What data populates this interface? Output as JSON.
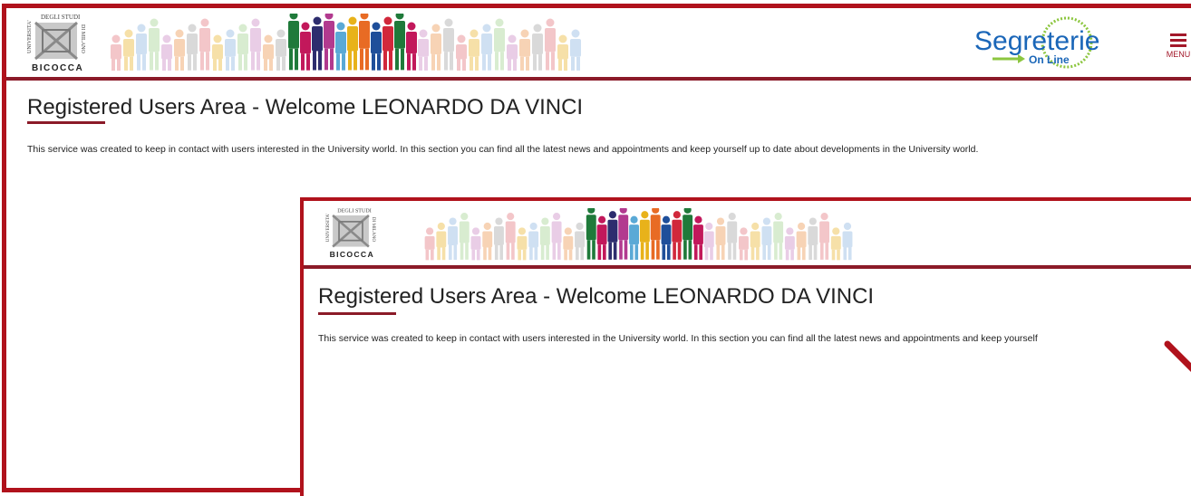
{
  "header": {
    "logo_text_top": "DEGLI STUDI",
    "logo_text_side_left": "UNIVERSITA'",
    "logo_text_side_right": "DI MILANO",
    "logo_text_bottom": "BICOCCA",
    "brand_word": "Segreterie",
    "brand_sub": "On Line",
    "menu_label": "MENU"
  },
  "main": {
    "title": "Registered Users Area - Welcome LEONARDO DA VINCI",
    "description": "This service was created to keep in contact with users interested in the University world. In this section you can find all the latest news and appointments and keep yourself up to date about developments in the University world."
  },
  "zoom_inset": {
    "title": "Registered Users Area - Welcome LEONARDO DA VINCI",
    "description": "This service was created to keep in contact with users interested in the University world. In this section you can find all the latest news and appointments and keep yourself"
  },
  "colors": {
    "accent": "#b0121c",
    "rule": "#8b1a28",
    "brand_blue": "#1a66b8",
    "brand_green": "#8cc63f"
  },
  "icons": [
    "university-logo-icon",
    "people-banner-icon",
    "segreterie-online-logo-icon",
    "hamburger-menu-icon",
    "annotation-arrow-icon"
  ]
}
